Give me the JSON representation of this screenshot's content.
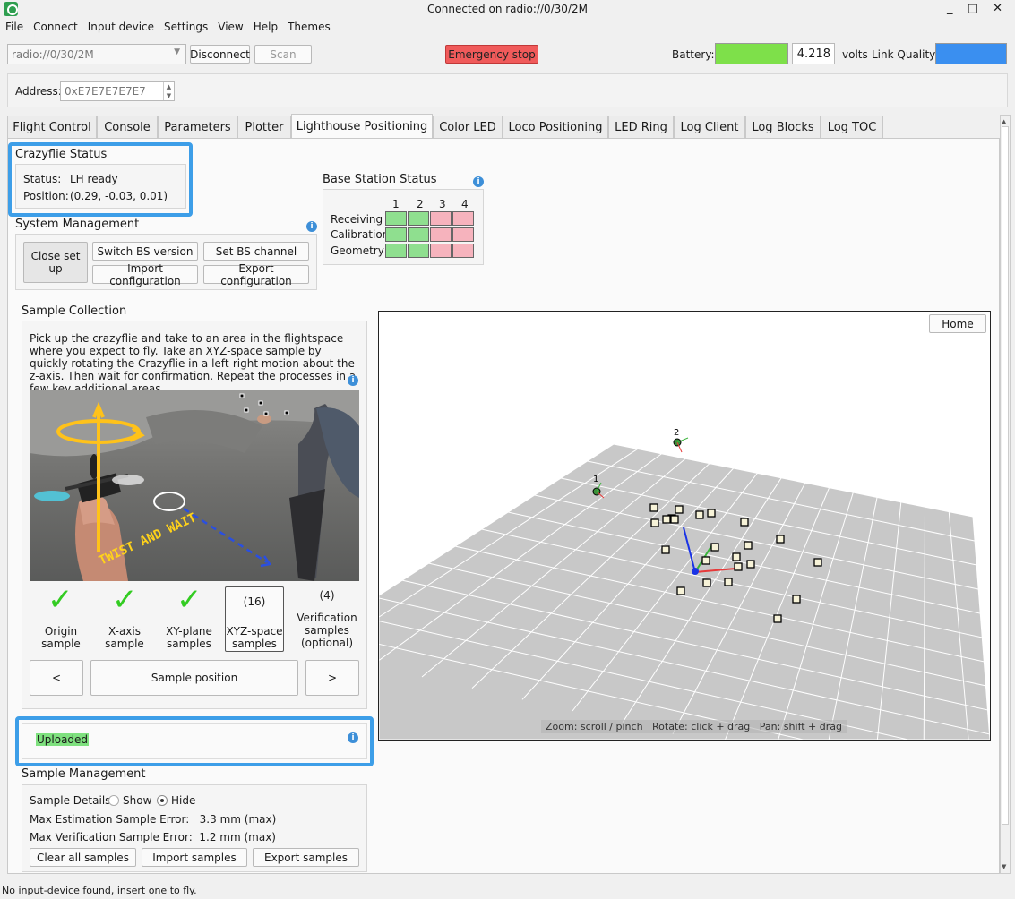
{
  "window": {
    "title": "Connected on radio://0/30/2M",
    "controls": "_ □ ✕"
  },
  "menu": [
    "File",
    "Connect",
    "Input device",
    "Settings",
    "View",
    "Help",
    "Themes"
  ],
  "toolbar": {
    "uri": "radio://0/30/2M",
    "disconnect": "Disconnect",
    "scan": "Scan",
    "emergency": "Emergency stop",
    "battery_label": "Battery:",
    "battery_value": "4.218",
    "battery_unit": "volts",
    "link_label": "Link Quality:",
    "battery_color": "#7ee04a",
    "link_color": "#3a8ff0"
  },
  "address": {
    "label": "Address:",
    "value": "0xE7E7E7E7E7"
  },
  "tabs": [
    "Flight Control",
    "Console",
    "Parameters",
    "Plotter",
    "Lighthouse Positioning",
    "Color LED",
    "Loco Positioning",
    "LED Ring",
    "Log Client",
    "Log Blocks",
    "Log TOC"
  ],
  "active_tab": "Lighthouse Positioning",
  "crazyflie_status": {
    "title": "Crazyflie Status",
    "status_label": "Status:",
    "status_value": "LH ready",
    "position_label": "Position:",
    "position_value": "(0.29, -0.03, 0.01)"
  },
  "base_station": {
    "title": "Base Station Status",
    "columns": [
      "1",
      "2",
      "3",
      "4"
    ],
    "rows": [
      {
        "label": "Receiving",
        "states": [
          "ok",
          "ok",
          "bad",
          "bad"
        ]
      },
      {
        "label": "Calibration",
        "states": [
          "ok",
          "ok",
          "bad",
          "bad"
        ]
      },
      {
        "label": "Geometry",
        "states": [
          "ok",
          "ok",
          "bad",
          "bad"
        ]
      }
    ]
  },
  "system_management": {
    "title": "System Management",
    "close_setup": "Close set up",
    "switch_bs": "Switch BS version",
    "set_bs_channel": "Set BS channel",
    "import_config": "Import configuration",
    "export_config": "Export configuration"
  },
  "sample_collection": {
    "title": "Sample Collection",
    "instructions": "Pick up the crazyflie and take to an area in the flightspace where you expect to fly. Take an XYZ-space sample by quickly rotating the Crazyflie in a left-right motion about the z-axis. Then wait for confirmation. Repeat the processes in a few key additional areas.",
    "image_text": "TWIST AND WAIT",
    "steps": [
      {
        "label": "Origin sample",
        "done": true
      },
      {
        "label": "X-axis sample",
        "done": true
      },
      {
        "label": "XY-plane samples",
        "done": true
      },
      {
        "label": "XYZ-space samples",
        "count": "(16)"
      },
      {
        "label": "Verification samples (optional)",
        "count": "(4)"
      }
    ],
    "prev": "<",
    "sample_position": "Sample position",
    "next": ">",
    "status": "Uploaded"
  },
  "sample_management": {
    "title": "Sample Management",
    "details_label": "Sample Details:",
    "show": "Show",
    "hide": "Hide",
    "est_error": "Max Estimation Sample Error:   3.3 mm (max)",
    "ver_error": "Max Verification Sample Error:  1.2 mm (max)",
    "clear": "Clear all samples",
    "import": "Import samples",
    "export": "Export samples"
  },
  "view3d": {
    "home": "Home",
    "hint": "Zoom: scroll / pinch   Rotate: click + drag   Pan: shift + drag",
    "bs1": "1",
    "bs2": "2"
  },
  "statusbar": "No input-device found, insert one to fly."
}
